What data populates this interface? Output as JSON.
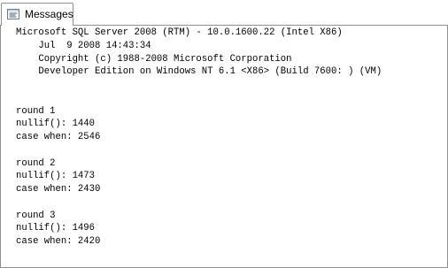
{
  "tab": {
    "label": "Messages",
    "icon": "messages-icon"
  },
  "messages": {
    "lines": [
      "Microsoft SQL Server 2008 (RTM) - 10.0.1600.22 (Intel X86)",
      "    Jul  9 2008 14:43:34",
      "    Copyright (c) 1988-2008 Microsoft Corporation",
      "    Developer Edition on Windows NT 6.1 <X86> (Build 7600: ) (VM)",
      "",
      "",
      "round 1",
      "nullif(): 1440",
      "case when: 2546",
      "",
      "round 2",
      "nullif(): 1473",
      "case when: 2430",
      "",
      "round 3",
      "nullif(): 1496",
      "case when: 2420"
    ]
  }
}
